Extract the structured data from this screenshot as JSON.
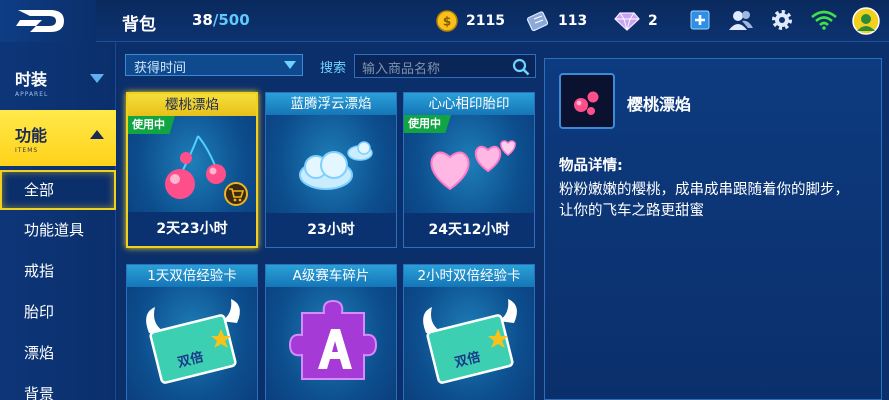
{
  "header": {
    "bag_title": "背包",
    "bag_current": "38",
    "bag_max": "/500",
    "coins": "2115",
    "tickets": "113",
    "diamonds": "2"
  },
  "sidebar": {
    "categories": [
      {
        "title": "时装",
        "sub": "APPAREL"
      },
      {
        "title": "功能",
        "sub": "ITEMS"
      }
    ],
    "items": [
      "全部",
      "功能道具",
      "戒指",
      "胎印",
      "漂焰",
      "背景"
    ]
  },
  "filter": {
    "sort_label": "获得时间"
  },
  "search": {
    "label": "搜索",
    "placeholder": "输入商品名称"
  },
  "cards": [
    {
      "name": "樱桃漂焰",
      "time": "2天23小时",
      "in_use": "使用中"
    },
    {
      "name": "蓝腾浮云漂焰",
      "time": "23小时"
    },
    {
      "name": "心心相印胎印",
      "time": "24天12小时",
      "in_use": "使用中"
    },
    {
      "name": "1天双倍经验卡"
    },
    {
      "name": "A级赛车碎片"
    },
    {
      "name": "2小时双倍经验卡"
    }
  ],
  "detail": {
    "name": "樱桃漂焰",
    "heading": "物品详情:",
    "description": "粉粉嫩嫩的樱桃，成串成串跟随着你的脚步，让你的飞车之路更甜蜜"
  },
  "colors": {
    "accent_yellow": "#f2d11e",
    "in_use_green": "#11a443",
    "background_blue": "#0b2f6b"
  },
  "icons": [
    "back-logo-icon",
    "coin-icon",
    "ticket-icon",
    "diamond-icon",
    "add-icon",
    "friends-icon",
    "settings-icon",
    "wifi-icon",
    "avatar-icon",
    "search-icon",
    "cart-icon"
  ]
}
